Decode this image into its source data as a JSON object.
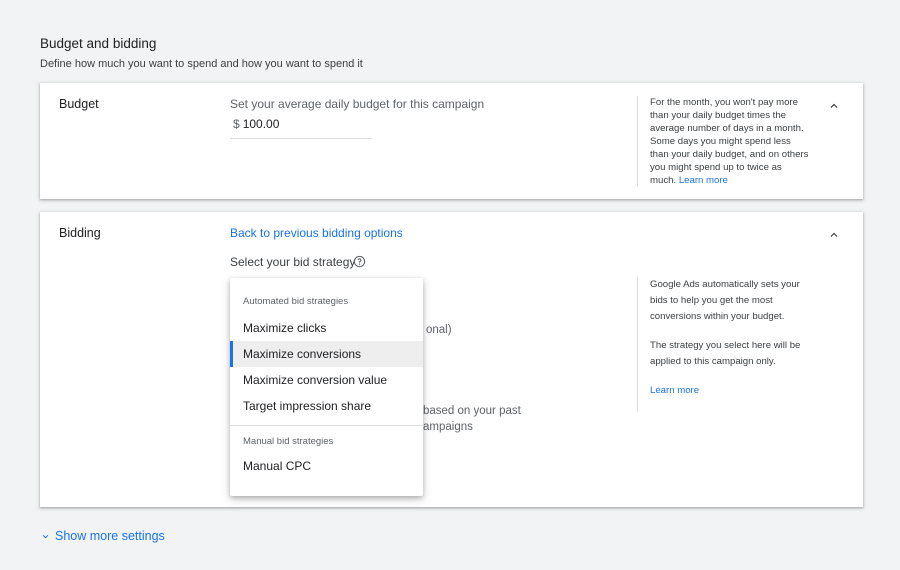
{
  "section": {
    "title": "Budget and bidding",
    "subtitle": "Define how much you want to spend and how you want to spend it"
  },
  "budget": {
    "label": "Budget",
    "prompt": "Set your average daily budget for this campaign",
    "currency_symbol": "$",
    "value": "100.00",
    "help_text": "For the month, you won't pay more than your daily budget times the average number of days in a month. Some days you might spend less than your daily budget, and on others you might spend up to twice as much.",
    "help_link": "Learn more"
  },
  "bidding": {
    "label": "Bidding",
    "back_link": "Back to previous bidding options",
    "strategy_label": "Select your bid strategy",
    "obscured_fragments": [
      "onal)",
      "based on your past",
      "ampaigns"
    ],
    "help_p1": "Google Ads automatically sets your bids to help you get the most conversions within your budget.",
    "help_p2": "The strategy you select here will be applied to this campaign only.",
    "help_link": "Learn more"
  },
  "dropdown": {
    "automated_header": "Automated bid strategies",
    "automated_items": [
      "Maximize clicks",
      "Maximize conversions",
      "Maximize conversion value",
      "Target impression share"
    ],
    "selected_item": "Maximize conversions",
    "manual_header": "Manual bid strategies",
    "manual_items": [
      "Manual CPC"
    ]
  },
  "footer": {
    "show_more": "Show more settings"
  },
  "icons": {
    "collapse": "chevron-up-icon",
    "help": "help-circle-icon",
    "expand": "chevron-down-icon"
  },
  "colors": {
    "accent": "#1a73e8",
    "background": "#f1f3f4"
  }
}
